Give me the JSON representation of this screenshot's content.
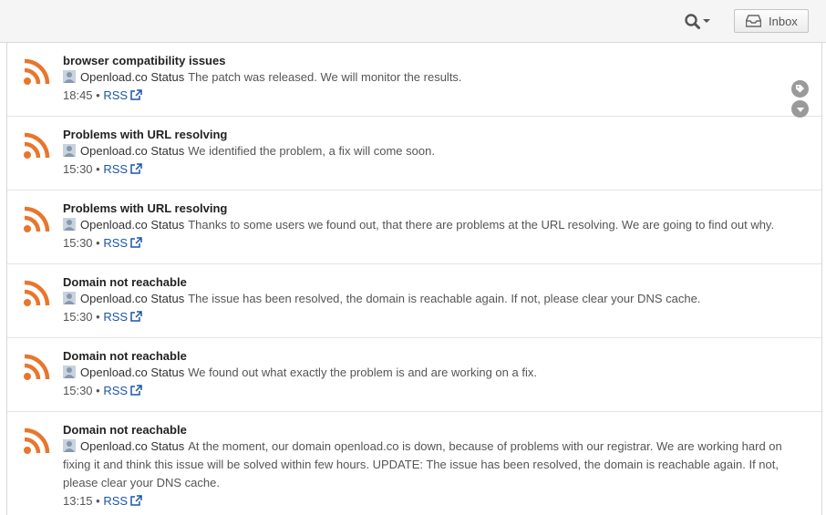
{
  "header": {
    "search_icon": "search-icon",
    "inbox_label": "Inbox"
  },
  "colors": {
    "rss_orange": "#e8762c",
    "link_blue": "#1a56a8",
    "icon_gray": "#9a9a9a"
  },
  "feed": {
    "items": [
      {
        "title": "browser compatibility issues",
        "author": "Openload.co Status",
        "text": "The patch was released. We will monitor the results.",
        "time": "18:45",
        "source": "RSS"
      },
      {
        "title": "Problems with URL resolving",
        "author": "Openload.co Status",
        "text": "We identified the problem, a fix will come soon.",
        "time": "15:30",
        "source": "RSS"
      },
      {
        "title": "Problems with URL resolving",
        "author": "Openload.co Status",
        "text": "Thanks to some users we found out, that there are problems at the URL resolving. We are going to find out why.",
        "time": "15:30",
        "source": "RSS"
      },
      {
        "title": "Domain not reachable",
        "author": "Openload.co Status",
        "text": "The issue has been resolved, the domain is reachable again. If not, please clear your DNS cache.",
        "time": "15:30",
        "source": "RSS"
      },
      {
        "title": "Domain not reachable",
        "author": "Openload.co Status",
        "text": "We found out what exactly the problem is and are working on a fix.",
        "time": "15:30",
        "source": "RSS"
      },
      {
        "title": "Domain not reachable",
        "author": "Openload.co Status",
        "text": "At the moment, our domain openload.co is down, because of problems with our registrar. We are working hard on fixing it and think this issue will be solved within few hours. UPDATE: The issue has been resolved, the domain is reachable again. If not, please clear your DNS cache.",
        "time": "13:15",
        "source": "RSS"
      }
    ]
  }
}
